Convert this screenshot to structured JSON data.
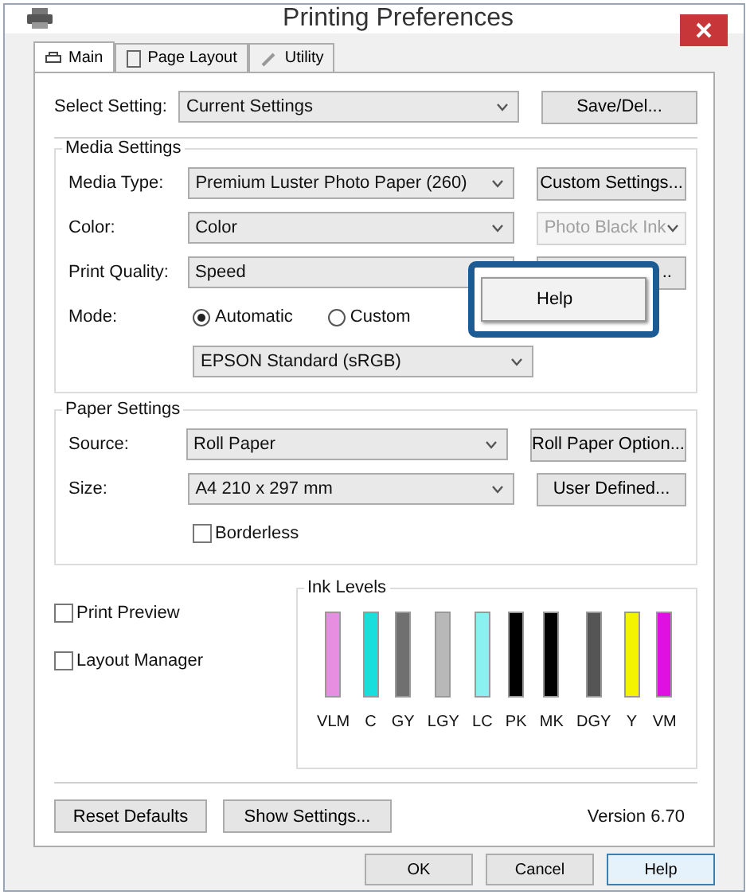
{
  "window": {
    "title": "Printing Preferences"
  },
  "tabs": [
    {
      "label": "Main",
      "selected": true
    },
    {
      "label": "Page Layout",
      "selected": false
    },
    {
      "label": "Utility",
      "selected": false
    }
  ],
  "select_setting": {
    "label": "Select Setting:",
    "value": "Current Settings",
    "button": "Save/Del..."
  },
  "media_settings": {
    "title": "Media Settings",
    "rows": [
      {
        "label": "Media Type:",
        "value": "Premium Luster Photo Paper (260)",
        "button": "Custom Settings...",
        "kind": "button"
      },
      {
        "label": "Color:",
        "value": "Color",
        "button": "Photo Black Ink",
        "kind": "dropdown"
      },
      {
        "label": "Print Quality:",
        "value": "Speed",
        "button": "..",
        "kind": "covered"
      }
    ],
    "mode": {
      "label": "Mode:",
      "options": [
        {
          "label": "Automatic",
          "selected": true
        },
        {
          "label": "Custom",
          "selected": false
        }
      ],
      "value": "EPSON Standard (sRGB)"
    }
  },
  "paper_settings": {
    "title": "Paper Settings",
    "rows": [
      {
        "label": "Source:",
        "value": "Roll Paper",
        "button": "Roll Paper Option..."
      },
      {
        "label": "Size:",
        "value": "A4 210 x 297 mm",
        "button": "User Defined..."
      }
    ],
    "borderless": {
      "label": "Borderless",
      "checked": false
    }
  },
  "options": [
    {
      "label": "Print Preview",
      "checked": false
    },
    {
      "label": "Layout Manager",
      "checked": false
    }
  ],
  "ink_levels": {
    "title": "Ink Levels",
    "inks": [
      {
        "label": "VLM",
        "color": "#e88ee0"
      },
      {
        "label": "C",
        "color": "#19dede"
      },
      {
        "label": "GY",
        "color": "#707070"
      },
      {
        "label": "LGY",
        "color": "#b8b8b8"
      },
      {
        "label": "LC",
        "color": "#8af0f0"
      },
      {
        "label": "PK",
        "color": "#000000"
      },
      {
        "label": "MK",
        "color": "#000000"
      },
      {
        "label": "DGY",
        "color": "#555555"
      },
      {
        "label": "Y",
        "color": "#f4f400"
      },
      {
        "label": "VM",
        "color": "#e010e0"
      }
    ]
  },
  "footer": {
    "buttons": [
      "Reset Defaults",
      "Show Settings..."
    ],
    "version": "Version 6.70"
  },
  "dialog_buttons": [
    {
      "label": "OK",
      "default": false
    },
    {
      "label": "Cancel",
      "default": false
    },
    {
      "label": "Help",
      "default": true
    }
  ],
  "popup": {
    "item": "Help"
  }
}
